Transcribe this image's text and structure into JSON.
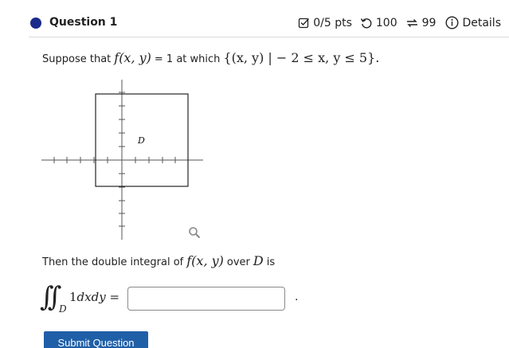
{
  "question": {
    "title": "Question 1",
    "points": "0/5 pts",
    "retries": "100",
    "submissions": "99",
    "details": "Details"
  },
  "prompt": {
    "text_before": "Suppose that",
    "function": "f(x, y)",
    "equals_text": "= 1 at which",
    "set": "{(x, y) | − 2 ≤ x, y ≤ 5}."
  },
  "graph": {
    "region_label": "D"
  },
  "line2": {
    "text_before": "Then the double integral of",
    "function": "f(x, y)",
    "middle": "over",
    "region": "D",
    "after": "is"
  },
  "integral": {
    "signs": "∫∫",
    "subscript": "D",
    "integrand": "1",
    "differential": "dxdy",
    "equals": "="
  },
  "answer": {
    "value": "",
    "placeholder": ""
  },
  "period": ".",
  "submit_label": "Submit Question",
  "colors": {
    "question_dot": "#1a2a8c",
    "submit_bg": "#1f5fa8"
  }
}
